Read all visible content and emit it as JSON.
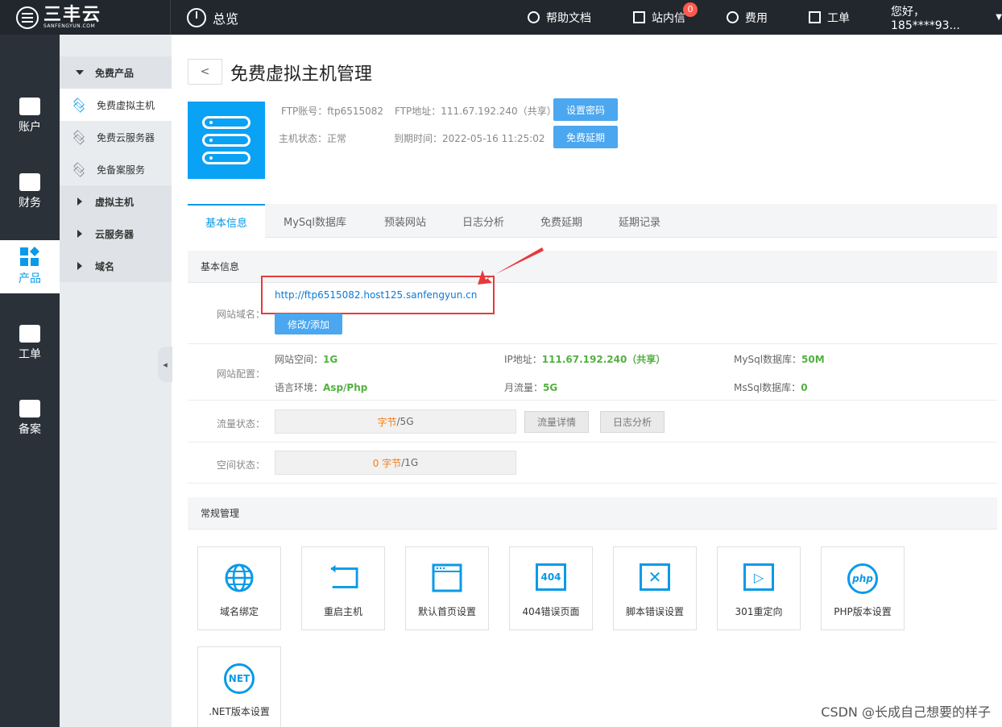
{
  "topbar": {
    "brand_cn": "三丰云",
    "brand_en": "SANFENGYUN.COM",
    "overview": "总览",
    "help": "帮助文档",
    "messages": "站内信",
    "messages_count": "0",
    "fees": "费用",
    "tickets": "工单",
    "greeting": "您好，185****93..."
  },
  "left_sidebar": [
    {
      "label": "账户",
      "icon": "id-card-icon"
    },
    {
      "label": "财务",
      "icon": "yen-icon"
    },
    {
      "label": "产品",
      "icon": "products-grid-icon"
    },
    {
      "label": "工单",
      "icon": "bag-icon"
    },
    {
      "label": "备案",
      "icon": "star-doc-icon"
    }
  ],
  "sub_sidebar": {
    "free_products": "免费产品",
    "free_vhost": "免费虚拟主机",
    "free_cloud": "免费云服务器",
    "free_beian": "免备案服务",
    "vhost": "虚拟主机",
    "cloud": "云服务器",
    "domain": "域名"
  },
  "main": {
    "back": "<",
    "title": "免费虚拟主机管理",
    "ftp_account_label": "FTP账号：",
    "ftp_account": "ftp6515082",
    "ftp_addr_label": "FTP地址：",
    "ftp_addr": "111.67.192.240（共享）",
    "status_label": "主机状态：",
    "status": "正常",
    "expire_label": "到期时间：",
    "expire": "2022-05-16 11:25:02",
    "btn_set_password": "设置密码",
    "btn_extend": "免费延期"
  },
  "tabs": [
    "基本信息",
    "MySql数据库",
    "预装网站",
    "日志分析",
    "免费延期",
    "延期记录"
  ],
  "basic": {
    "section_title": "基本信息",
    "domain_label": "网站域名：",
    "domain_url": "http://ftp6515082.host125.sanfengyun.cn",
    "btn_modify": "修改/添加",
    "config_label": "网站配置：",
    "space_label": "网站空间：",
    "space_value": "1G",
    "ip_label": "IP地址：",
    "ip_value": "111.67.192.240（共享）",
    "mysql_label": "MySql数据库：",
    "mysql_value": "50M",
    "lang_label": "语言环境：",
    "lang_value": "Asp/Php",
    "traffic_label": "月流量：",
    "traffic_value": "5G",
    "mssql_label": "MsSql数据库：",
    "mssql_value": "0",
    "flow_state_label": "流量状态：",
    "flow_used": "字节",
    "flow_total": "/5G",
    "btn_flow_detail": "流量详情",
    "btn_log": "日志分析",
    "space_state_label": "空间状态：",
    "space_used": "0 字节",
    "space_total": "/1G"
  },
  "manage": {
    "section_title": "常规管理",
    "tiles": [
      {
        "label": "域名绑定",
        "icon": "globe-icon"
      },
      {
        "label": "重启主机",
        "icon": "restart-icon"
      },
      {
        "label": "默认首页设置",
        "icon": "browser-window-icon"
      },
      {
        "label": "404错误页面",
        "icon": "404-icon",
        "glyph": "404"
      },
      {
        "label": "脚本错误设置",
        "icon": "script-error-icon",
        "glyph": "✕"
      },
      {
        "label": "301重定向",
        "icon": "redirect-icon",
        "glyph": "▷"
      },
      {
        "label": "PHP版本设置",
        "icon": "php-icon",
        "glyph": "php"
      },
      {
        "label": ".NET版本设置",
        "icon": "dotnet-icon",
        "glyph": "NET"
      }
    ]
  },
  "watermark": "CSDN @长成自己想要的样子",
  "colors": {
    "accent": "#0a9ae8",
    "topbar": "#22272e",
    "sidebar": "#2a3139",
    "highlight": "#e8393a",
    "value_green": "#52b140"
  }
}
